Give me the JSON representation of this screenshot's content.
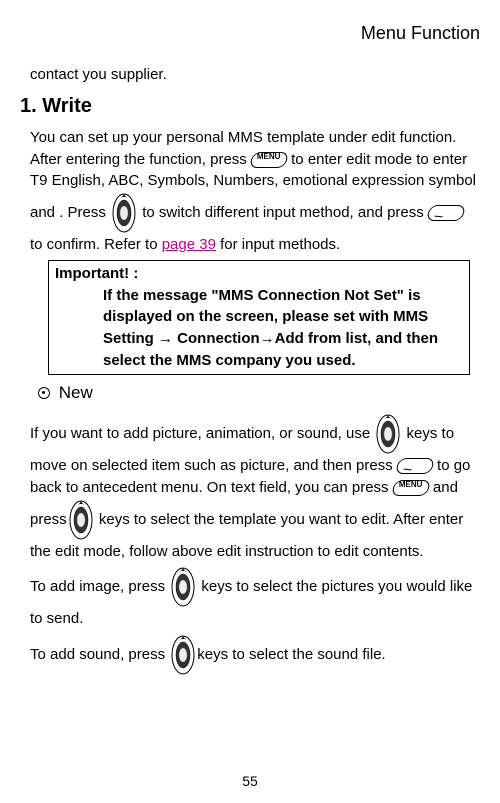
{
  "header": {
    "title": "Menu Function"
  },
  "intro": {
    "text": "contact you supplier."
  },
  "section": {
    "number": "1.",
    "title": "Write"
  },
  "para1": {
    "line1": "You can set up your personal MMS template under edit function. After entering the function, press ",
    "line2": " to enter edit mode to enter T9 English, ABC, Symbols, Numbers, emotional expression symbol and .   Press ",
    "line3": " to switch different input method, and press ",
    "line4": " to confirm.   Refer to ",
    "link": "page 39",
    "line5": " for input methods."
  },
  "important": {
    "label": "Important! :",
    "content": "If the message \"MMS Connection Not Set\" is displayed on the screen, please set with MMS Setting → Connection→Add from list, and then select the MMS company you used."
  },
  "subheading": {
    "title": "New"
  },
  "para2": {
    "line1": "If you want to add picture, animation, or sound, use ",
    "line2": " keys to move on selected item such as picture, and then press ",
    "line3": " to go back to antecedent menu.   On text field, you can press ",
    "line4": " and press",
    "line5": " keys to select the template you want to edit.   After enter the edit mode, follow above edit instruction to edit contents."
  },
  "para3": {
    "line1": "To add image, press ",
    "line2": " keys to select the pictures you would like to send."
  },
  "para4": {
    "line1": "To add sound, press ",
    "line2": "keys to select the sound file."
  },
  "pageNumber": "55"
}
